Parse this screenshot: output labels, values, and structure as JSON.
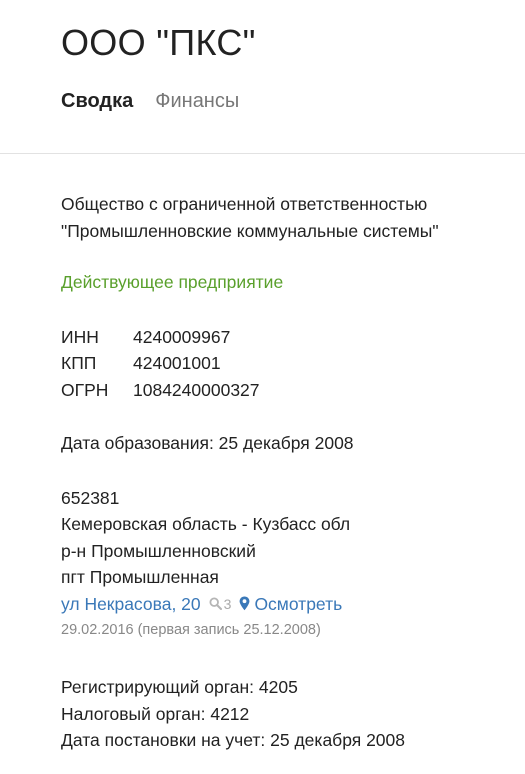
{
  "company": {
    "title": "ООО \"ПКС\""
  },
  "tabs": [
    {
      "label": "Сводка",
      "active": true
    },
    {
      "label": "Финансы",
      "active": false
    }
  ],
  "details": {
    "full_name_line1": "Общество с ограниченной ответственностью",
    "full_name_line2": "\"Промышленновские коммунальные системы\"",
    "status": "Действующее предприятие",
    "identifiers": [
      {
        "label": "ИНН",
        "value": "4240009967"
      },
      {
        "label": "КПП",
        "value": "424001001"
      },
      {
        "label": "ОГРН",
        "value": "1084240000327"
      }
    ],
    "registration_date": "Дата образования: 25 декабря 2008"
  },
  "address": {
    "postal_code": "652381",
    "region": "Кемеровская область - Кузбасс обл",
    "district": "р-н Промышленновский",
    "locality": "пгт Промышленная",
    "street": "ул Некрасова, 20",
    "search_count": "3",
    "map_link": "Осмотреть",
    "date_note": "29.02.2016 (первая запись 25.12.2008)"
  },
  "registry": {
    "registering_authority": "Регистрирующий орган: 4205",
    "tax_authority": "Налоговый орган: 4212",
    "tax_registration_date": "Дата постановки на учет: 25 декабря 2008"
  },
  "colors": {
    "status": "#5aa02c",
    "link": "#3a78b8",
    "muted": "#888888"
  },
  "icons": {
    "search": "search-icon",
    "map_pin": "map-pin-icon"
  }
}
